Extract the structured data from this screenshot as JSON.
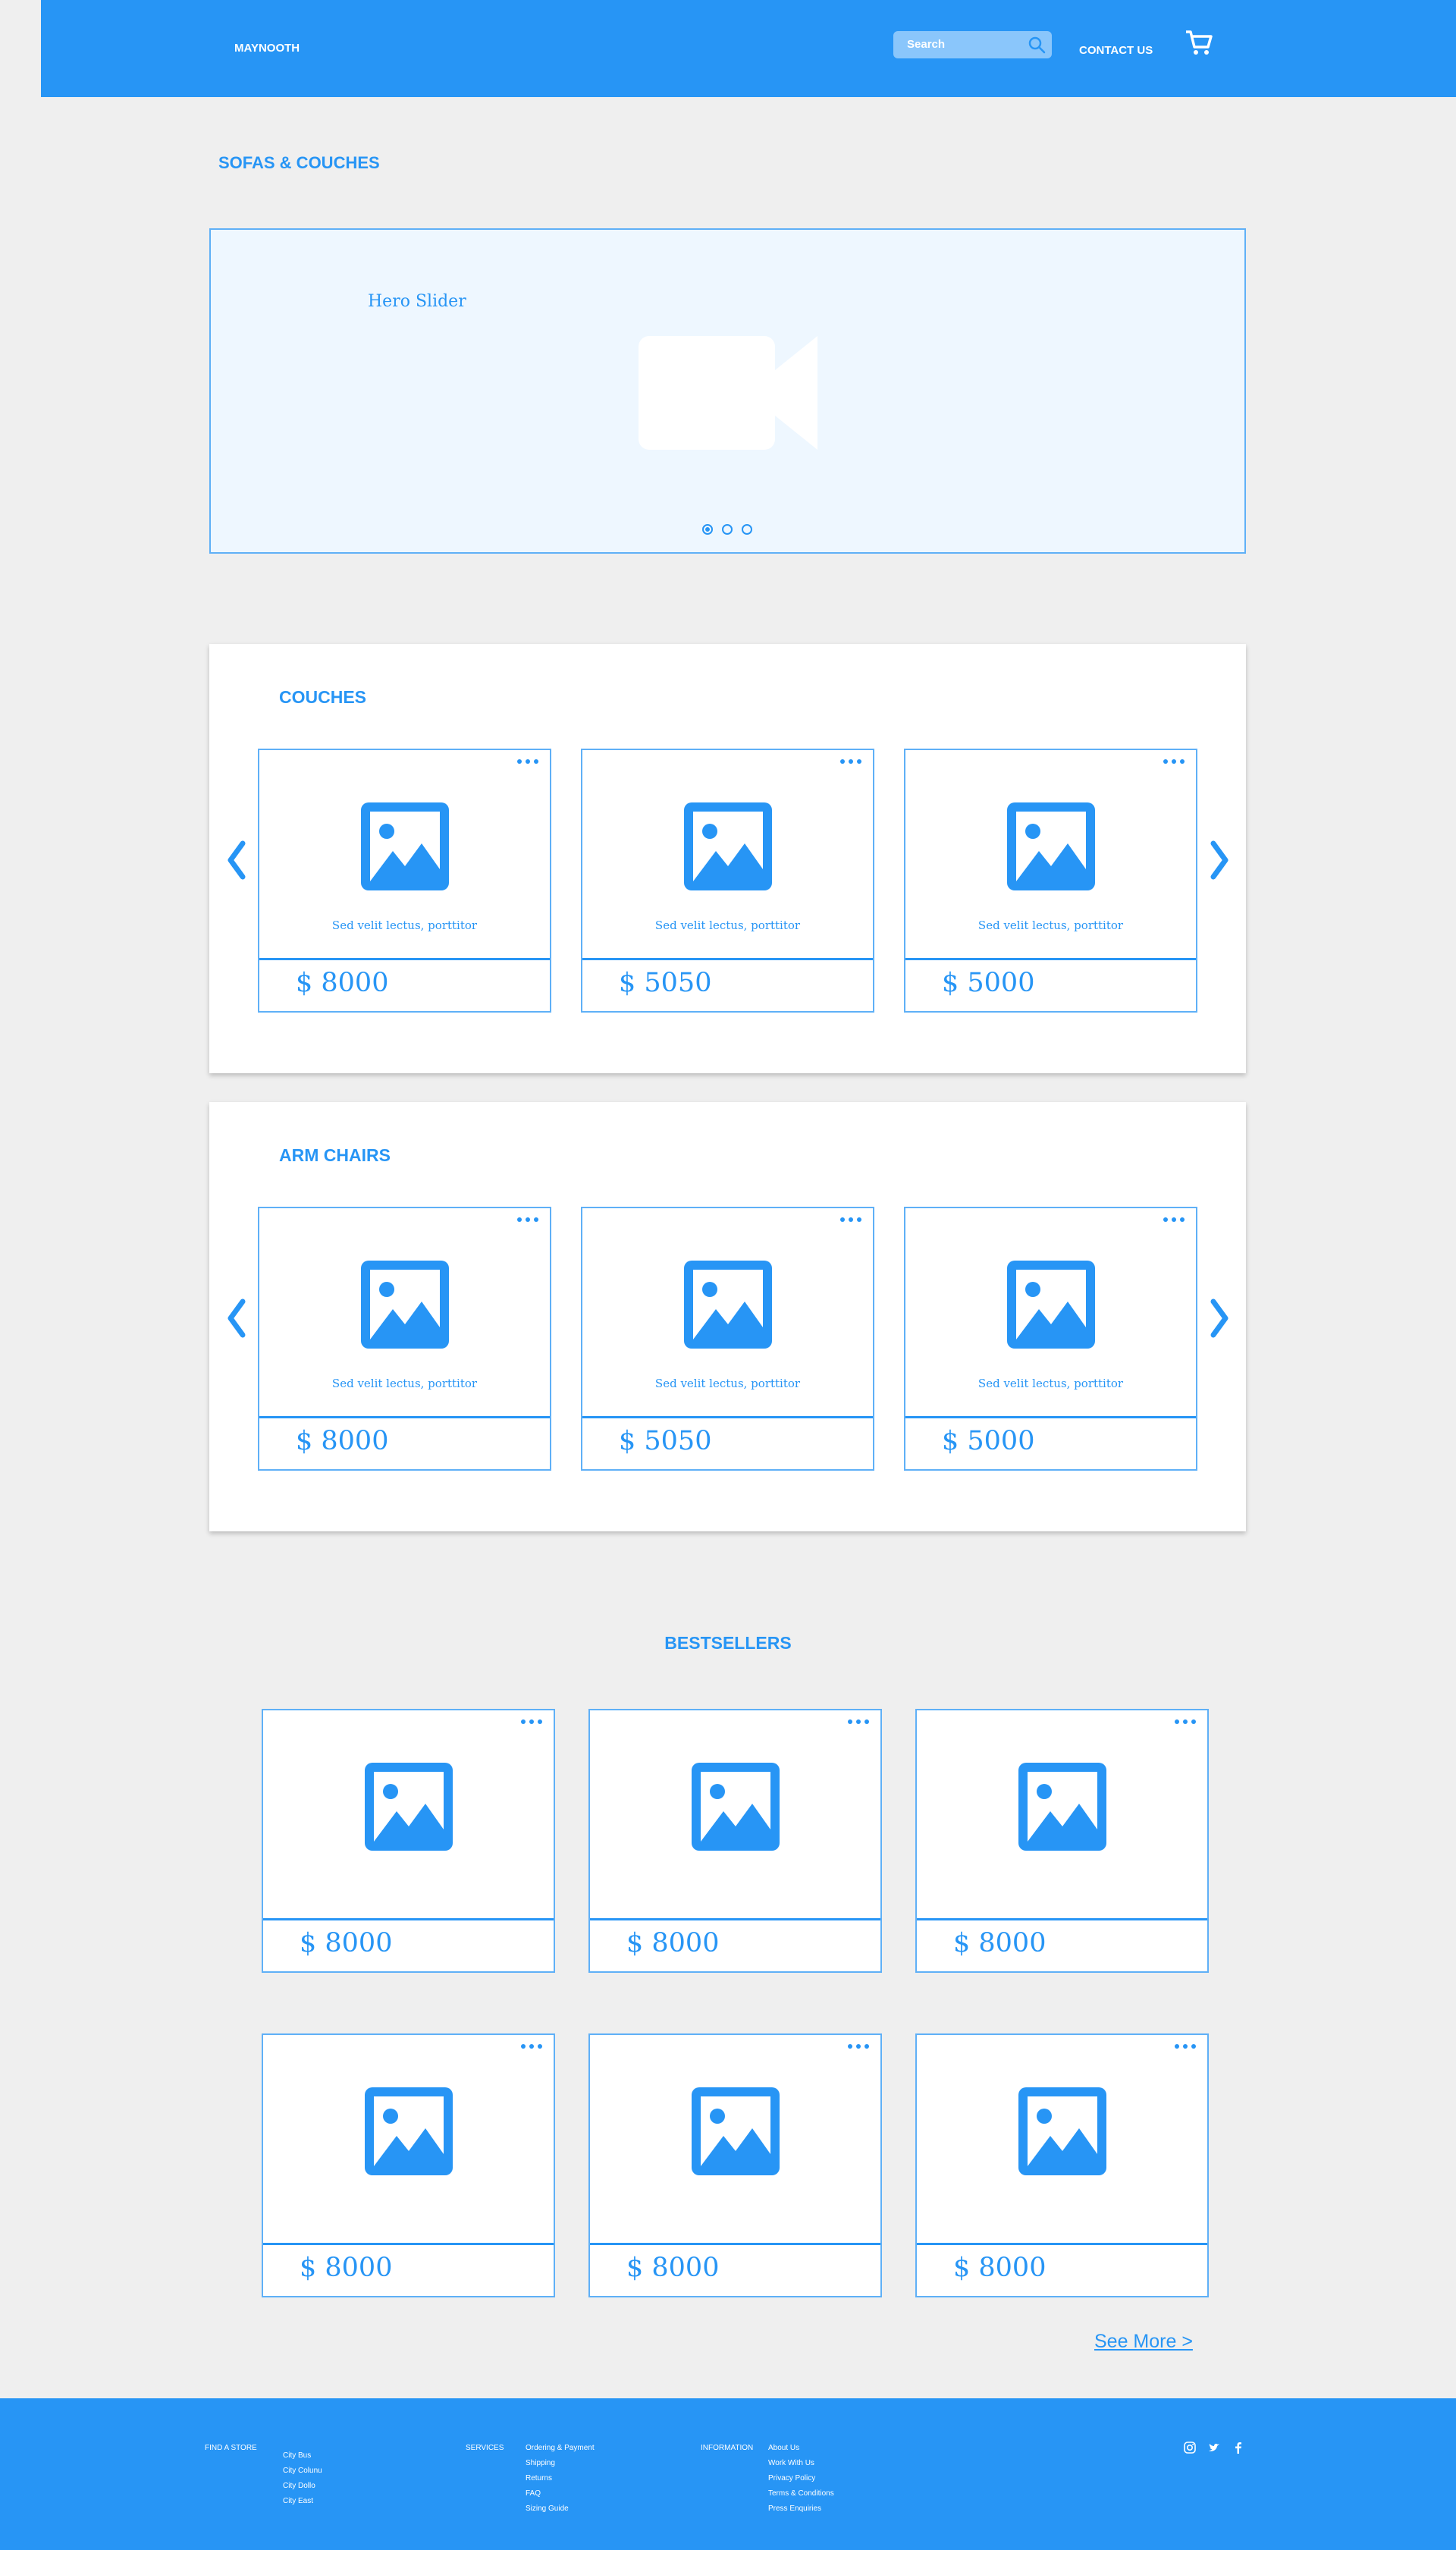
{
  "header": {
    "brand": "MAYNOOTH",
    "search_placeholder": "Search",
    "contact_label": "CONTACT US",
    "icons": [
      "search-icon",
      "cart-icon"
    ]
  },
  "page_title": "SOFAS & COUCHES",
  "hero": {
    "label": "Hero Slider",
    "slides": 3,
    "active_slide": 1
  },
  "couches": {
    "title": "COUCHES",
    "products": [
      {
        "desc": "Sed velit lectus, porttitor",
        "price": "$ 8000"
      },
      {
        "desc": "Sed velit lectus, porttitor",
        "price": "$ 5050"
      },
      {
        "desc": "Sed velit lectus, porttitor",
        "price": "$ 5000"
      }
    ]
  },
  "armchairs": {
    "title": "ARM CHAIRS",
    "products": [
      {
        "desc": "Sed velit lectus, porttitor",
        "price": "$ 8000"
      },
      {
        "desc": "Sed velit lectus, porttitor",
        "price": "$ 5050"
      },
      {
        "desc": "Sed velit lectus, porttitor",
        "price": "$ 5000"
      }
    ]
  },
  "bestsellers": {
    "title": "BESTSELLERS",
    "products": [
      {
        "price": "$ 8000"
      },
      {
        "price": "$ 8000"
      },
      {
        "price": "$ 8000"
      },
      {
        "price": "$ 8000"
      },
      {
        "price": "$ 8000"
      },
      {
        "price": "$ 8000"
      }
    ],
    "see_more": "See More >"
  },
  "footer": {
    "find_store": {
      "heading": "FIND A STORE",
      "items": [
        "City Bus",
        "City Colunu",
        "City Dollo",
        "City East"
      ]
    },
    "services": {
      "heading": "SERVICES",
      "items": [
        "Ordering & Payment",
        "Shipping",
        "Returns",
        "FAQ",
        "Sizing Guide"
      ]
    },
    "information": {
      "heading": "INFORMATION",
      "items": [
        "About Us",
        "Work With Us",
        "Privacy Policy",
        "Terms & Conditions",
        "Press Enquiries"
      ]
    },
    "social": [
      "instagram-icon",
      "twitter-icon",
      "facebook-icon"
    ]
  },
  "colors": {
    "accent": "#2795f5",
    "background": "#efefef",
    "hero_bg": "#eef7ff"
  }
}
